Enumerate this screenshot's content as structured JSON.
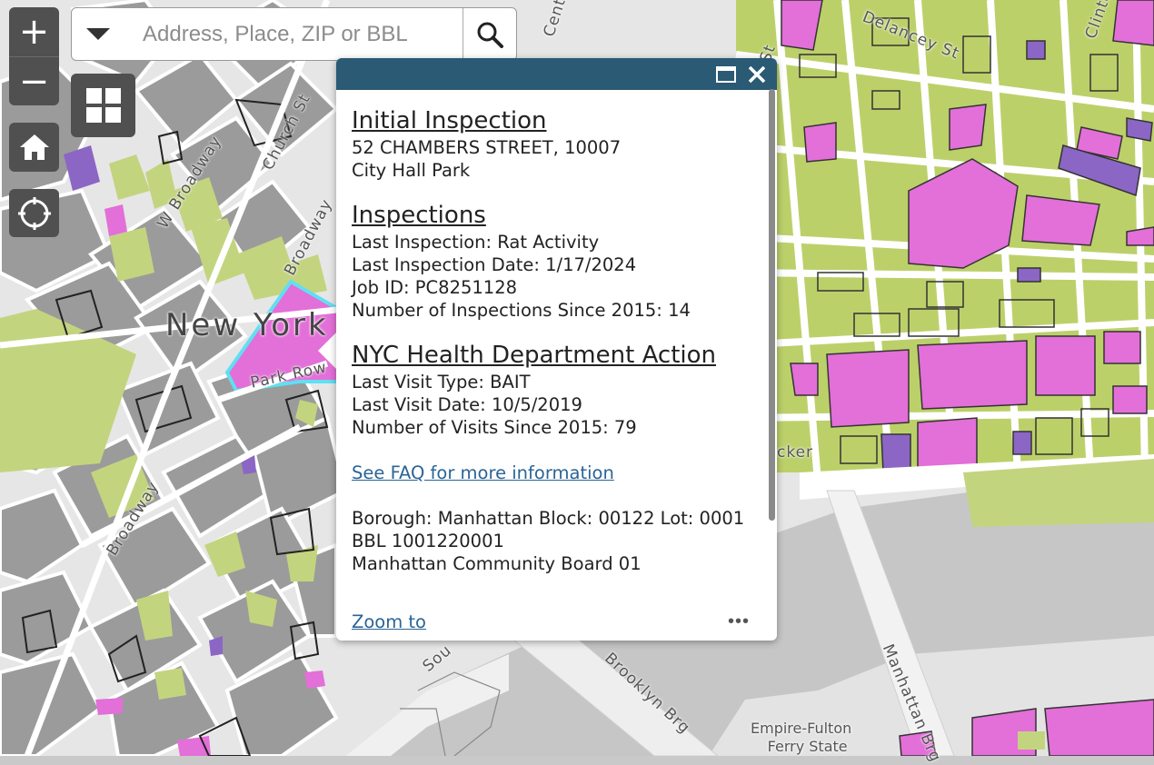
{
  "search": {
    "placeholder": "Address, Place, ZIP or BBL",
    "value": ""
  },
  "controls": {
    "zoom_in": "+",
    "zoom_out": "−"
  },
  "map": {
    "labels": {
      "city": "New York",
      "park_row": "Park Row",
      "w_broadway": "W Broadway",
      "church_st": "Church St",
      "broadway_n": "Broadway",
      "broadway_s": "Broadway",
      "delancey": "Delancey St",
      "centre": "Centre",
      "clinton": "Clinto",
      "st_frag": "St",
      "bkr": "cker",
      "south": "Sou",
      "brooklyn_brg": "Brooklyn Brg",
      "manhattan_brg": "Manhattan Brg",
      "empire_fulton_1": "Empire-Fulton",
      "empire_fulton_2": "Ferry State"
    },
    "colors": {
      "water": "#c6c6c6",
      "land": "#e8e8e8",
      "block_gray": "#9b9b9b",
      "park_green": "#c3d47f",
      "parcel_green": "#bcd06a",
      "parcel_pink": "#e36fd8",
      "parcel_purple": "#8c66c4",
      "highlight_outline": "#5fe0f2"
    }
  },
  "popup": {
    "section1_title": "Initial Inspection",
    "address": "52 CHAMBERS STREET, 10007",
    "place_name": "City Hall Park",
    "section2_title": "Inspections ",
    "last_inspection": "Last Inspection: Rat Activity",
    "last_inspection_date": "Last Inspection Date: 1/17/2024",
    "job_id": "Job ID: PC8251128",
    "inspections_count": "Number of Inspections Since 2015: 14",
    "section3_title": "NYC Health Department Action",
    "last_visit_type": "Last Visit Type: BAIT",
    "last_visit_date": "Last Visit Date: 10/5/2019",
    "visits_count": "Number of Visits Since 2015: 79",
    "faq_link": "See FAQ for more information",
    "borough_line": "Borough: Manhattan  Block: 00122 Lot: 0001",
    "bbl_line": "BBL 1001220001",
    "community_board": "Manhattan Community Board 01",
    "zoom_to": "Zoom to",
    "more": "•••"
  }
}
